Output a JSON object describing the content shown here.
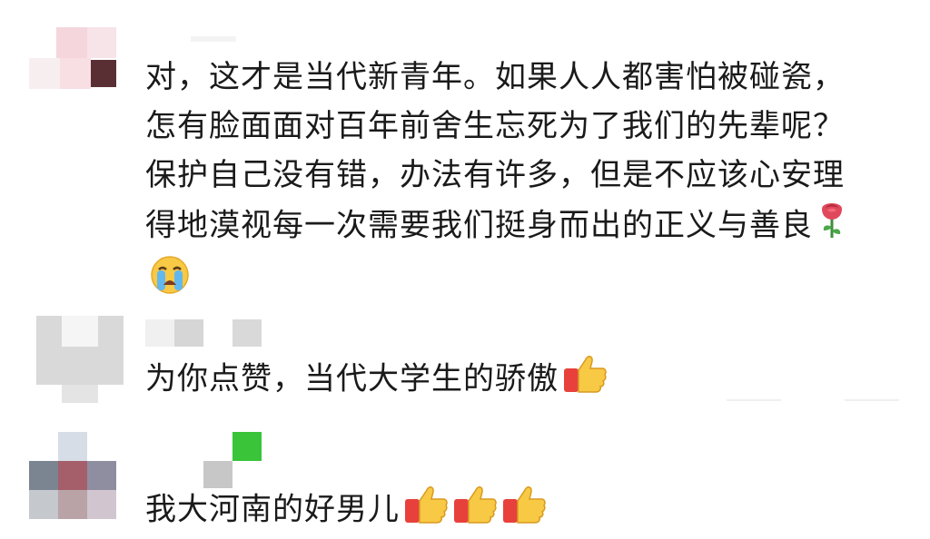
{
  "comments": [
    {
      "text": "对，这才是当代新青年。如果人人都害怕被碰瓷，怎有脸面面对百年前舍生忘死为了我们的先辈呢？保护自己没有错，办法有许多，但是不应该心安理得地漠视每一次需要我们挺身而出的正义与善良",
      "emojis": [
        "rose-icon",
        "crying-face-icon"
      ]
    },
    {
      "text": "为你点赞，当代大学生的骄傲",
      "emojis": [
        "thumbs-up-icon"
      ]
    },
    {
      "text": "我大河南的好男儿",
      "emojis": [
        "thumbs-up-icon",
        "thumbs-up-icon",
        "thumbs-up-icon"
      ]
    }
  ]
}
